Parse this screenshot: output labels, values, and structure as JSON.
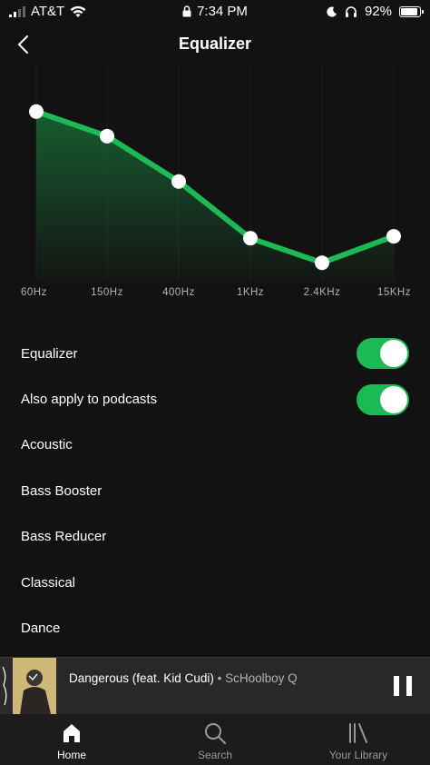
{
  "status_bar": {
    "carrier": "AT&T",
    "time": "7:34 PM",
    "battery": "92%"
  },
  "header": {
    "title": "Equalizer"
  },
  "equalizer": {
    "bands": [
      "60Hz",
      "150Hz",
      "400Hz",
      "1KHz",
      "2.4KHz",
      "15KHz"
    ],
    "levels": [
      0.9,
      0.77,
      0.53,
      0.23,
      0.1,
      0.24
    ],
    "accent_color": "#1db954"
  },
  "settings": [
    {
      "label": "Equalizer",
      "toggle": true
    },
    {
      "label": "Also apply to podcasts",
      "toggle": true
    },
    {
      "label": "Acoustic"
    },
    {
      "label": "Bass Booster"
    },
    {
      "label": "Bass Reducer"
    },
    {
      "label": "Classical"
    },
    {
      "label": "Dance"
    }
  ],
  "now_playing": {
    "title": "Dangerous (feat. Kid Cudi)",
    "separator": "•",
    "artist": "ScHoolboy Q"
  },
  "tabs": [
    {
      "label": "Home",
      "icon": "home-icon",
      "active": true
    },
    {
      "label": "Search",
      "icon": "search-icon",
      "active": false
    },
    {
      "label": "Your Library",
      "icon": "library-icon",
      "active": false
    }
  ]
}
